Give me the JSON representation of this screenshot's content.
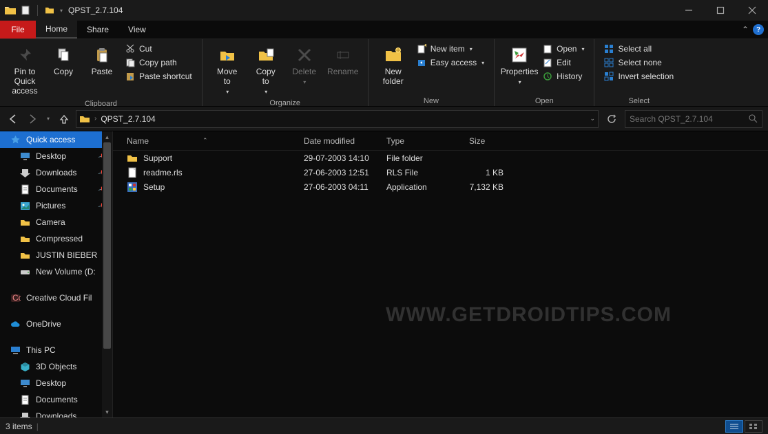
{
  "window": {
    "title": "QPST_2.7.104"
  },
  "tabs": {
    "file": "File",
    "home": "Home",
    "share": "Share",
    "view": "View"
  },
  "ribbon": {
    "pin": "Pin to Quick\naccess",
    "copy": "Copy",
    "paste": "Paste",
    "cut": "Cut",
    "copy_path": "Copy path",
    "paste_shortcut": "Paste shortcut",
    "clipboard_group": "Clipboard",
    "move_to": "Move\nto",
    "copy_to": "Copy\nto",
    "delete": "Delete",
    "rename": "Rename",
    "organize_group": "Organize",
    "new_folder": "New\nfolder",
    "new_item": "New item",
    "easy_access": "Easy access",
    "new_group": "New",
    "properties": "Properties",
    "open": "Open",
    "edit": "Edit",
    "history": "History",
    "open_group": "Open",
    "select_all": "Select all",
    "select_none": "Select none",
    "invert_selection": "Invert selection",
    "select_group": "Select"
  },
  "address": {
    "path": "QPST_2.7.104"
  },
  "search": {
    "placeholder": "Search QPST_2.7.104"
  },
  "sidebar": {
    "quick_access": "Quick access",
    "items": [
      "Desktop",
      "Downloads",
      "Documents",
      "Pictures",
      "Camera",
      "Compressed",
      "JUSTIN BIEBER",
      "New Volume (D:"
    ],
    "creative": "Creative Cloud Fil",
    "onedrive": "OneDrive",
    "thispc": "This PC",
    "pc_items": [
      "3D Objects",
      "Desktop",
      "Documents",
      "Downloads"
    ]
  },
  "columns": {
    "name": "Name",
    "date": "Date modified",
    "type": "Type",
    "size": "Size"
  },
  "files": [
    {
      "name": "Support",
      "date": "29-07-2003 14:10",
      "type": "File folder",
      "size": "",
      "icon": "folder"
    },
    {
      "name": "readme.rls",
      "date": "27-06-2003 12:51",
      "type": "RLS File",
      "size": "1 KB",
      "icon": "file"
    },
    {
      "name": "Setup",
      "date": "27-06-2003 04:11",
      "type": "Application",
      "size": "7,132 KB",
      "icon": "app"
    }
  ],
  "status": {
    "text": "3 items"
  },
  "watermark": "WWW.GETDROIDTIPS.COM"
}
